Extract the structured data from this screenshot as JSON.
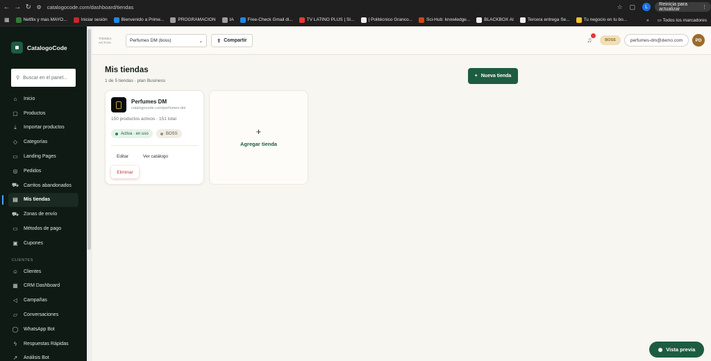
{
  "browser": {
    "url": "catalogocode.com/dashboard/tiendas",
    "profile_initial": "L",
    "update_label": "Reinicia para actualizar",
    "bookmarks": [
      {
        "label": "Netflix y mas MAYO...",
        "color": "#2e7d32"
      },
      {
        "label": "Iniciar sesión",
        "color": "#c62828"
      },
      {
        "label": "Bienvenido a Prime...",
        "color": "#1e88e5"
      },
      {
        "label": "PROGRAMACION",
        "color": "#9e9e9e"
      },
      {
        "label": "IA",
        "color": "#9e9e9e"
      },
      {
        "label": "Free-Check Gmail di...",
        "color": "#1e88e5"
      },
      {
        "label": "TV LATINO PLUS | SI...",
        "color": "#e53935"
      },
      {
        "label": "| Politécnico Granco...",
        "color": "#eeeeee"
      },
      {
        "label": "Sci-Hub: knowledge...",
        "color": "#d84315"
      },
      {
        "label": "BLACKBOX AI",
        "color": "#eeeeee"
      },
      {
        "label": "Tercera entrega Se...",
        "color": "#eeeeee"
      },
      {
        "label": "Tu negocio en tu bo...",
        "color": "#fbc02d"
      }
    ],
    "all_bookmarks": "Todos los marcadores"
  },
  "sidebar": {
    "brand": "CatalogoCode",
    "search_placeholder": "Buscar en el panel...",
    "items": [
      {
        "label": "Inicio",
        "icon": "home-icon",
        "glyph": "⌂"
      },
      {
        "label": "Productos",
        "icon": "box-icon",
        "glyph": "▢"
      },
      {
        "label": "Importar productos",
        "icon": "download-icon",
        "glyph": "⤓"
      },
      {
        "label": "Categorías",
        "icon": "tag-icon",
        "glyph": "◇"
      },
      {
        "label": "Landing Pages",
        "icon": "page-icon",
        "glyph": "▭"
      },
      {
        "label": "Pedidos",
        "icon": "orders-icon",
        "glyph": "◎"
      },
      {
        "label": "Carritos abandonados",
        "icon": "cart-icon",
        "glyph": "⛟"
      },
      {
        "label": "Mis tiendas",
        "icon": "store-icon",
        "glyph": "▤",
        "active": true
      },
      {
        "label": "Zonas de envío",
        "icon": "truck-icon",
        "glyph": "⛟"
      },
      {
        "label": "Métodos de pago",
        "icon": "card-icon",
        "glyph": "▭"
      },
      {
        "label": "Cupones",
        "icon": "coupon-icon",
        "glyph": "▣"
      }
    ],
    "section_clientes": "CLIENTES",
    "items2": [
      {
        "label": "Clientes",
        "icon": "users-icon",
        "glyph": "☺"
      },
      {
        "label": "CRM Dashboard",
        "icon": "crm-icon",
        "glyph": "▦"
      },
      {
        "label": "Campañas",
        "icon": "megaphone-icon",
        "glyph": "◁"
      },
      {
        "label": "Conversaciones",
        "icon": "chat-icon",
        "glyph": "▱"
      },
      {
        "label": "WhatsApp Bot",
        "icon": "whatsapp-icon",
        "glyph": "◯"
      },
      {
        "label": "Respuestas Rápidas",
        "icon": "bolt-icon",
        "glyph": "ϟ"
      },
      {
        "label": "Análisis Bot",
        "icon": "chart-icon",
        "glyph": "↗"
      }
    ]
  },
  "topbar": {
    "store_label_line1": "TIENDA",
    "store_label_line2": "ACTIVA",
    "store_selected": "Perfumes DM (boss)",
    "share_label": "Compartir",
    "plan_badge": "BOSS",
    "user_email": "perfumes-dm@demo.com",
    "avatar_initials": "PD"
  },
  "main": {
    "title": "Mis tiendas",
    "subtitle": "1 de 5 tiendas · plan Business",
    "new_store_label": "Nueva tienda",
    "store": {
      "name": "Perfumes DM",
      "url": "catalogocode.com/perfumes-dm",
      "count": "150 productos activos · 151 total",
      "status": "Activa · en uso",
      "plan": "BOSS",
      "edit": "Editar",
      "view": "Ver catálogo",
      "delete": "Eliminar"
    },
    "add_store_label": "Agregar tienda",
    "preview_label": "Vista previa"
  }
}
